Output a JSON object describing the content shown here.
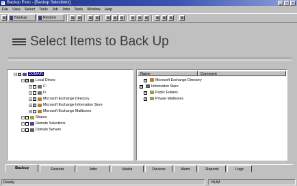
{
  "window": {
    "title": "Backup Exec - [Backup Selections]",
    "controls": [
      "_",
      "□",
      "×"
    ]
  },
  "menu": [
    "File",
    "View",
    "Select",
    "Tools",
    "Job",
    "Jobs",
    "Tools",
    "Window",
    "Help"
  ],
  "toolbar": {
    "backup_label": "Backup",
    "restore_label": "Restore"
  },
  "banner": {
    "title": "Select Items to Back Up"
  },
  "tree": {
    "nodes": [
      {
        "label": "DOMAIN",
        "level": 0,
        "expander": "−",
        "check": "gray",
        "selected": true,
        "icon": "network-icon",
        "color": "#4a4a8a"
      },
      {
        "label": "Local Drives",
        "level": 1,
        "expander": "−",
        "check": "gray",
        "icon": "computer-icon",
        "color": "#4a6a4a"
      },
      {
        "label": "C:",
        "level": 2,
        "expander": "+",
        "check": "off",
        "icon": "drive-icon",
        "color": "#707070"
      },
      {
        "label": "D:",
        "level": 2,
        "expander": "+",
        "check": "off",
        "icon": "drive-icon",
        "color": "#707070"
      },
      {
        "label": "Microsoft Exchange Directory",
        "level": 2,
        "expander": "+",
        "check": "on",
        "icon": "exchange-icon",
        "color": "#b08040"
      },
      {
        "label": "Microsoft Exchange Information Store",
        "level": 2,
        "expander": "+",
        "check": "on",
        "icon": "exchange-icon",
        "color": "#b08040"
      },
      {
        "label": "Microsoft Exchange Mailboxes",
        "level": 2,
        "expander": "+",
        "check": "off",
        "icon": "exchange-icon",
        "color": "#b08040"
      },
      {
        "label": "Shares",
        "level": 1,
        "expander": "+",
        "check": "off",
        "icon": "share-icon",
        "color": "#a0a040"
      },
      {
        "label": "Remote Selections",
        "level": 1,
        "expander": "+",
        "check": "off",
        "icon": "network-icon",
        "color": "#4a4a8a"
      },
      {
        "label": "Domain Servers",
        "level": 1,
        "expander": "+",
        "check": "off",
        "icon": "server-icon",
        "color": "#606060"
      }
    ]
  },
  "list": {
    "columns": [
      "Name",
      "Comment"
    ],
    "rows": [
      {
        "label": "Microsoft Exchange Directory",
        "check": "on",
        "indent": 1,
        "color": "#b08040"
      },
      {
        "label": "Information Store",
        "check": "gray",
        "indent": 0,
        "color": "#4a6a4a"
      },
      {
        "label": "Public Folders",
        "check": "on",
        "indent": 1,
        "color": "#a0a040"
      },
      {
        "label": "Private Mailboxes",
        "check": "on",
        "indent": 1,
        "color": "#a0a040"
      }
    ]
  },
  "tabs": [
    "Backup",
    "Restore",
    "Jobs",
    "Media",
    "Devices",
    "Alerts",
    "Reports",
    "Logs"
  ],
  "status": {
    "left": "Ready",
    "right": "NUM"
  }
}
